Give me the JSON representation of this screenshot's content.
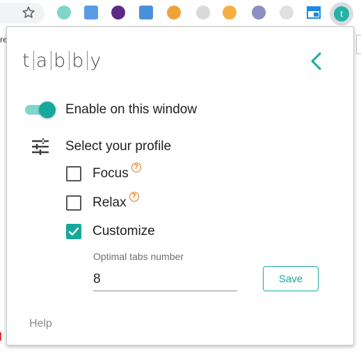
{
  "popup": {
    "logo_letters": [
      "t",
      "a",
      "b",
      "b",
      "y"
    ],
    "enable_label": "Enable on this window",
    "enable_on": true,
    "profile_title": "Select your profile",
    "options": [
      {
        "label": "Focus",
        "checked": false,
        "has_help": true
      },
      {
        "label": "Relax",
        "checked": false,
        "has_help": true
      },
      {
        "label": "Customize",
        "checked": true,
        "has_help": false
      }
    ],
    "help_mark": "?",
    "tabs_field": {
      "label": "Optimal tabs number",
      "value": "8"
    },
    "save_label": "Save",
    "help_label": "Help",
    "accent_color": "#16a99b"
  },
  "toolbar": {
    "edge_text": "re",
    "active_extension_glyph": "t"
  }
}
